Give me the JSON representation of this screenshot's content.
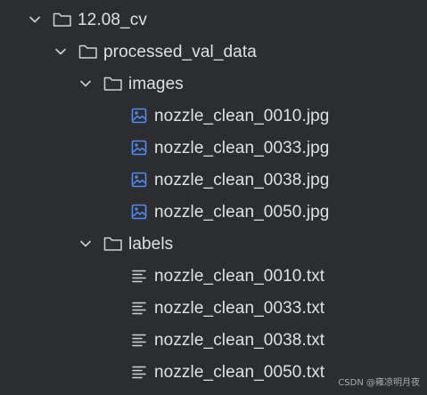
{
  "tree": {
    "root": {
      "label": "12.08_cv",
      "expanded": true,
      "icon": "folder-icon"
    },
    "processed": {
      "label": "processed_val_data",
      "expanded": true,
      "icon": "folder-icon"
    },
    "images": {
      "label": "images",
      "expanded": true,
      "icon": "folder-icon",
      "files": [
        {
          "name": "nozzle_clean_0010.jpg",
          "icon": "image-file-icon"
        },
        {
          "name": "nozzle_clean_0033.jpg",
          "icon": "image-file-icon"
        },
        {
          "name": "nozzle_clean_0038.jpg",
          "icon": "image-file-icon"
        },
        {
          "name": "nozzle_clean_0050.jpg",
          "icon": "image-file-icon"
        }
      ]
    },
    "labels": {
      "label": "labels",
      "expanded": true,
      "icon": "folder-icon",
      "files": [
        {
          "name": "nozzle_clean_0010.txt",
          "icon": "text-file-icon"
        },
        {
          "name": "nozzle_clean_0033.txt",
          "icon": "text-file-icon"
        },
        {
          "name": "nozzle_clean_0038.txt",
          "icon": "text-file-icon"
        },
        {
          "name": "nozzle_clean_0050.txt",
          "icon": "text-file-icon"
        }
      ]
    }
  },
  "watermark": "CSDN @雍凉明月夜",
  "colors": {
    "background": "#2b2d30",
    "text": "#dfe1e5",
    "icon_outline": "#cfd1d5",
    "image_icon": "#4f8df5"
  }
}
